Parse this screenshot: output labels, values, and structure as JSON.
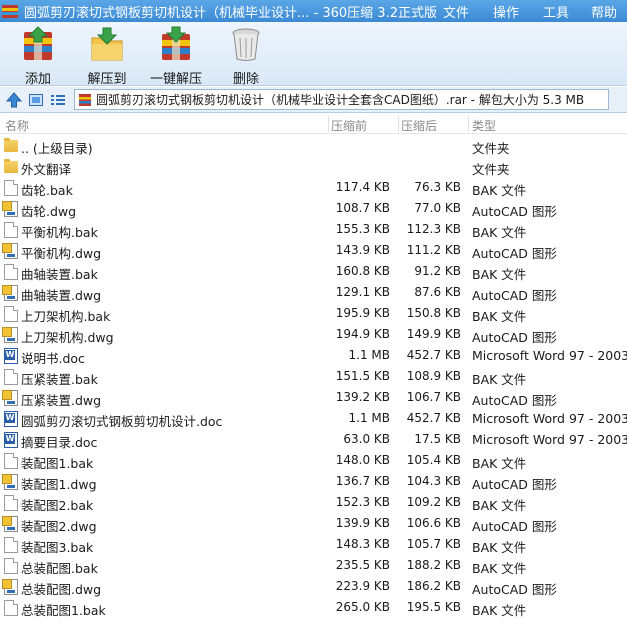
{
  "window": {
    "title": "圆弧剪刃滚切式钢板剪切机设计（机械毕业设计... - 360压缩 3.2正式版",
    "menu": [
      "文件",
      "操作",
      "工具",
      "帮助"
    ]
  },
  "toolbar": {
    "add_label": "添加",
    "extract_label": "解压到",
    "one_click_label": "一键解压",
    "delete_label": "删除"
  },
  "address": {
    "path": "圆弧剪刃滚切式钢板剪切机设计（机械毕业设计全套含CAD图纸）.rar - 解包大小为 5.3 MB"
  },
  "columns": {
    "name": "名称",
    "size": "压缩前",
    "packed": "压缩后",
    "type": "类型"
  },
  "files": [
    {
      "icon": "folder",
      "name": ".. (上级目录)",
      "size": "",
      "packed": "",
      "type": "文件夹"
    },
    {
      "icon": "folder",
      "name": "外文翻译",
      "size": "",
      "packed": "",
      "type": "文件夹"
    },
    {
      "icon": "bak",
      "name": "齿轮.bak",
      "size": "117.4 KB",
      "packed": "76.3 KB",
      "type": "BAK 文件"
    },
    {
      "icon": "dwg",
      "name": "齿轮.dwg",
      "size": "108.7 KB",
      "packed": "77.0 KB",
      "type": "AutoCAD 图形"
    },
    {
      "icon": "bak",
      "name": "平衡机构.bak",
      "size": "155.3 KB",
      "packed": "112.3 KB",
      "type": "BAK 文件"
    },
    {
      "icon": "dwg",
      "name": "平衡机构.dwg",
      "size": "143.9 KB",
      "packed": "111.2 KB",
      "type": "AutoCAD 图形"
    },
    {
      "icon": "bak",
      "name": "曲轴装置.bak",
      "size": "160.8 KB",
      "packed": "91.2 KB",
      "type": "BAK 文件"
    },
    {
      "icon": "dwg",
      "name": "曲轴装置.dwg",
      "size": "129.1 KB",
      "packed": "87.6 KB",
      "type": "AutoCAD 图形"
    },
    {
      "icon": "bak",
      "name": "上刀架机构.bak",
      "size": "195.9 KB",
      "packed": "150.8 KB",
      "type": "BAK 文件"
    },
    {
      "icon": "dwg",
      "name": "上刀架机构.dwg",
      "size": "194.9 KB",
      "packed": "149.9 KB",
      "type": "AutoCAD 图形"
    },
    {
      "icon": "doc",
      "name": "说明书.doc",
      "size": "1.1 MB",
      "packed": "452.7 KB",
      "type": "Microsoft Word 97 - 2003"
    },
    {
      "icon": "bak",
      "name": "压紧装置.bak",
      "size": "151.5 KB",
      "packed": "108.9 KB",
      "type": "BAK 文件"
    },
    {
      "icon": "dwg",
      "name": "压紧装置.dwg",
      "size": "139.2 KB",
      "packed": "106.7 KB",
      "type": "AutoCAD 图形"
    },
    {
      "icon": "doc",
      "name": "圆弧剪刃滚切式钢板剪切机设计.doc",
      "size": "1.1 MB",
      "packed": "452.7 KB",
      "type": "Microsoft Word 97 - 2003"
    },
    {
      "icon": "doc",
      "name": "摘要目录.doc",
      "size": "63.0 KB",
      "packed": "17.5 KB",
      "type": "Microsoft Word 97 - 2003"
    },
    {
      "icon": "bak",
      "name": "装配图1.bak",
      "size": "148.0 KB",
      "packed": "105.4 KB",
      "type": "BAK 文件"
    },
    {
      "icon": "dwg",
      "name": "装配图1.dwg",
      "size": "136.7 KB",
      "packed": "104.3 KB",
      "type": "AutoCAD 图形"
    },
    {
      "icon": "bak",
      "name": "装配图2.bak",
      "size": "152.3 KB",
      "packed": "109.2 KB",
      "type": "BAK 文件"
    },
    {
      "icon": "dwg",
      "name": "装配图2.dwg",
      "size": "139.9 KB",
      "packed": "106.6 KB",
      "type": "AutoCAD 图形"
    },
    {
      "icon": "bak",
      "name": "装配图3.bak",
      "size": "148.3 KB",
      "packed": "105.7 KB",
      "type": "BAK 文件"
    },
    {
      "icon": "bak",
      "name": "总装配图.bak",
      "size": "235.5 KB",
      "packed": "188.2 KB",
      "type": "BAK 文件"
    },
    {
      "icon": "dwg",
      "name": "总装配图.dwg",
      "size": "223.9 KB",
      "packed": "186.2 KB",
      "type": "AutoCAD 图形"
    },
    {
      "icon": "bak",
      "name": "总装配图1.bak",
      "size": "265.0 KB",
      "packed": "195.5 KB",
      "type": "BAK 文件"
    }
  ]
}
